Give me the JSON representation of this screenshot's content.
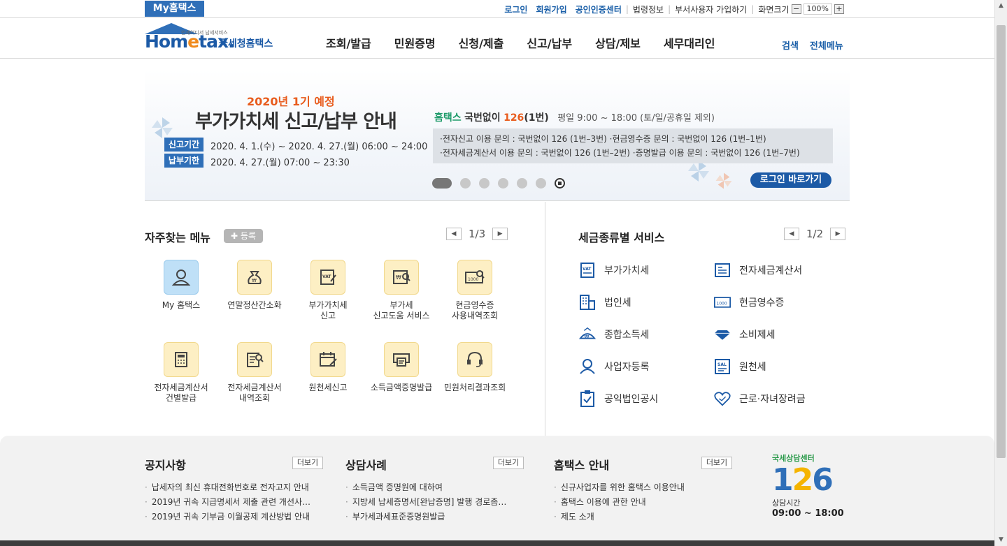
{
  "topbar": {
    "my_hometax": "My홈택스",
    "login": "로그인",
    "signup": "회원가입",
    "cert_center": "공인인증센터",
    "law_info": "법령정보",
    "dept_signup": "부서사용자 가입하기",
    "screen_size": "화면크기",
    "zoom_out": "−",
    "zoom_value": "100%",
    "zoom_in": "+"
  },
  "header": {
    "logo_text": "Hometax.",
    "logo_text_pre": "Hom",
    "logo_text_e": "e",
    "logo_text_post": "tax.",
    "logo_tiny": "언제어디서 납세서비스",
    "logo_sub": "국세청홈택스",
    "nav": [
      "조회/발급",
      "민원증명",
      "신청/제출",
      "신고/납부",
      "상담/제보",
      "세무대리인"
    ],
    "search": "검색",
    "all_menu": "전체메뉴"
  },
  "banner": {
    "year": "2020년 1기 예정",
    "title": "부가가치세 신고/납부 안내",
    "tag1": "신고기간",
    "tag1_text": "2020. 4. 1.(수) ~ 2020. 4. 27.(월) 06:00 ~ 24:00",
    "tag2": "납부기한",
    "tag2_text": "2020. 4. 27.(월) 07:00 ~ 23:30",
    "help_brand": "홈택스",
    "help_pre": "국번없이",
    "help_num": "126",
    "help_suffix": "(1번)",
    "help_hours": "평일 9:00 ~ 18:00 (토/일/공휴일 제외)",
    "box_line1": "·전자신고 이용 문의 : 국번없이 126 (1번–3번)   ·현금영수증 문의 : 국번없이 126 (1번–1번)",
    "box_line2": "·전자세금계산서 이용 문의 : 국번없이 126 (1번–2번)   ·증명발급 이용 문의 : 국번없이 126 (1번–7번)",
    "login_button": "로그인 바로가기"
  },
  "favorites": {
    "title": "자주찾는 메뉴",
    "add_button": "✚ 등록",
    "page": "1/3",
    "items": [
      {
        "label": "My 홈택스",
        "icon": "person-icon"
      },
      {
        "label": "연말정산간소화",
        "icon": "money-bag-icon"
      },
      {
        "label": "부가가치세\n신고",
        "icon": "vat-doc-icon"
      },
      {
        "label": "부가세\n신고도움 서비스",
        "icon": "won-search-icon"
      },
      {
        "label": "현금영수증\n사용내역조회",
        "icon": "receipt-search-icon"
      },
      {
        "label": "전자세금계산서\n건별발급",
        "icon": "calculator-icon"
      },
      {
        "label": "전자세금계산서\n내역조회",
        "icon": "invoice-search-icon"
      },
      {
        "label": "원천세신고",
        "icon": "calendar-edit-icon"
      },
      {
        "label": "소득금액증명발급",
        "icon": "printer-icon"
      },
      {
        "label": "민원처리결과조회",
        "icon": "headset-icon"
      }
    ]
  },
  "tax_services": {
    "title": "세금종류별 서비스",
    "page": "1/2",
    "items": [
      {
        "label": "부가가치세",
        "icon": "vat-icon"
      },
      {
        "label": "전자세금계산서",
        "icon": "e-invoice-icon"
      },
      {
        "label": "법인세",
        "icon": "building-icon"
      },
      {
        "label": "현금영수증",
        "icon": "cash-receipt-icon"
      },
      {
        "label": "종합소득세",
        "icon": "income-tax-icon"
      },
      {
        "label": "소비제세",
        "icon": "diamond-icon"
      },
      {
        "label": "사업자등록",
        "icon": "person-icon"
      },
      {
        "label": "원천세",
        "icon": "withholding-icon"
      },
      {
        "label": "공익법인공시",
        "icon": "clipboard-icon"
      },
      {
        "label": "근로·자녀장려금",
        "icon": "heart-icon"
      }
    ]
  },
  "bottom": {
    "notice": {
      "title": "공지사항",
      "more": "더보기",
      "items": [
        "납세자의 최신 휴대전화번호로 전자고지 안내",
        "2019년 귀속 지급명세서 제출 관련 개선사…",
        "2019년 귀속 기부금 이월공제 계산방법 안내"
      ]
    },
    "cases": {
      "title": "상담사례",
      "more": "더보기",
      "items": [
        "소득금액 증명원에 대하여",
        "지방세 납세증명서[완납증명] 발행 경로좀…",
        "부가세과세표준증명원발급"
      ]
    },
    "guide": {
      "title": "홈택스 안내",
      "more": "더보기",
      "items": [
        "신규사업자를 위한 홈택스 이용안내",
        "홈택스 이용에 관한 안내",
        "제도 소개"
      ]
    },
    "call_center": {
      "top": "국세상담센터",
      "num_a": "1",
      "num_b": "2",
      "num_c": "6",
      "hours_label": "상담시간",
      "hours": "09:00 ~ 18:00"
    }
  }
}
